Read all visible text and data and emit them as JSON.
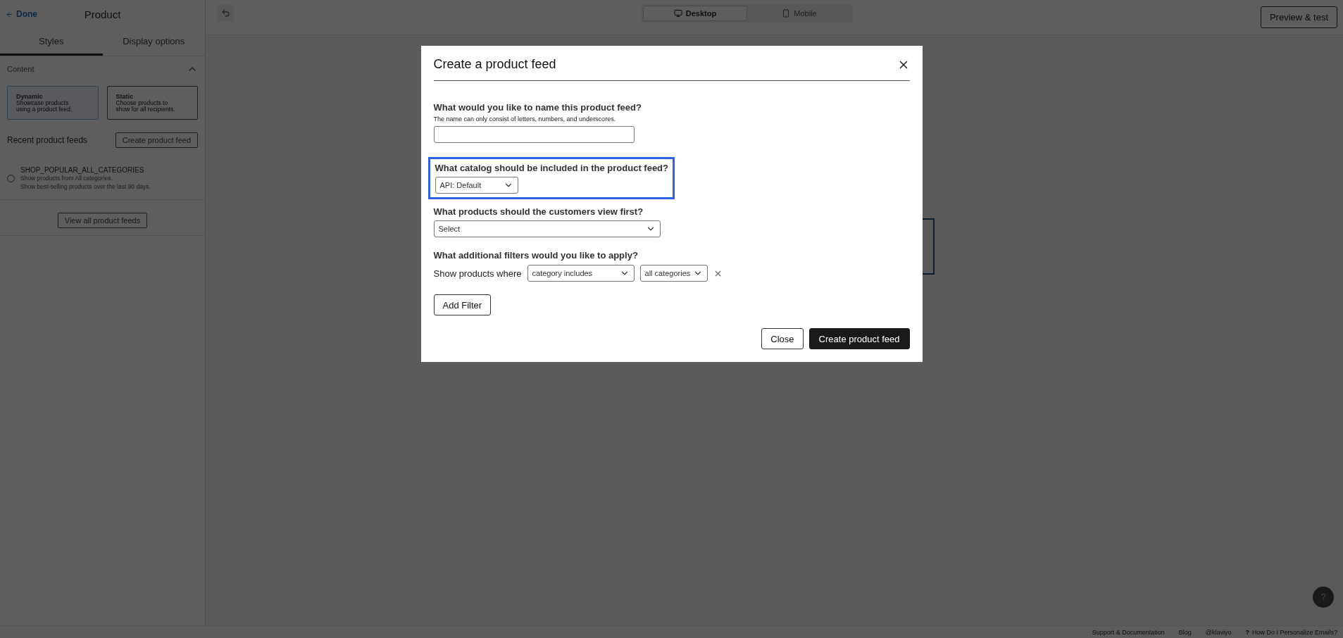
{
  "sidebar": {
    "back_link": "Done",
    "title": "Product",
    "tabs": [
      {
        "label": "Styles",
        "selected": true
      },
      {
        "label": "Display options",
        "selected": false
      }
    ],
    "section": {
      "title": "Content",
      "expanded": true
    },
    "content_options": [
      {
        "title": "Dynamic",
        "description": "Showcase products using a product feed.",
        "selected": true
      },
      {
        "title": "Static",
        "description": "Choose products to show for all recipients.",
        "selected": false
      }
    ],
    "recent_title": "Recent product feeds",
    "create_button": "Create product feed",
    "feeds": [
      {
        "name": "SHOP_POPULAR_ALL_CATEGORIES",
        "lines": [
          "Show products from All categories.",
          "Show best-selling products over the last 90 days."
        ],
        "selected": false
      }
    ],
    "view_all_button": "View all product feeds"
  },
  "toolbar": {
    "views": [
      {
        "label": "Desktop",
        "kind": "desktop",
        "selected": true
      },
      {
        "label": "Mobile",
        "kind": "mobile",
        "selected": false
      }
    ],
    "preview_button": "Preview & test"
  },
  "modal": {
    "title": "Create a product feed",
    "name_question": {
      "label": "What would you like to name this product feed?",
      "hint": "The name can only consist of letters, numbers, and underscores."
    },
    "catalog_question": {
      "label": "What catalog should be included in the product feed?",
      "value": "API: Default",
      "focused": true
    },
    "order_question": {
      "label": "What products should the customers view first?",
      "value": "Select"
    },
    "filters": {
      "label": "What additional filters would you like to apply?",
      "prefix": "Show products where",
      "field": "category includes",
      "value": "all categories"
    },
    "add_filter_button": "Add Filter",
    "close_button": "Close",
    "create_button": "Create product feed"
  },
  "footer": {
    "links": [
      {
        "label": "Support & Documentation",
        "kind": "text"
      },
      {
        "label": "Blog",
        "kind": "text"
      },
      {
        "label": "@klaviyo",
        "kind": "text"
      },
      {
        "label": "How Do I Personalize Emails?",
        "kind": "help",
        "icon": "?"
      }
    ],
    "help_button": "?"
  }
}
